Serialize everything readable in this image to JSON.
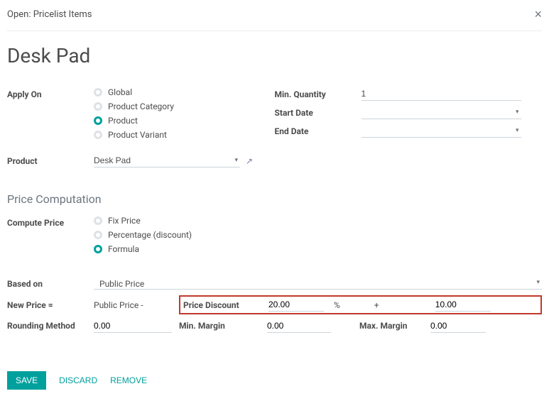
{
  "modal": {
    "title": "Open: Pricelist Items",
    "close": "×"
  },
  "page_title": "Desk Pad",
  "apply_on": {
    "label": "Apply On",
    "options": {
      "global": "Global",
      "category": "Product Category",
      "product": "Product",
      "variant": "Product Variant"
    }
  },
  "product": {
    "label": "Product",
    "value": "Desk Pad"
  },
  "right": {
    "min_qty": {
      "label": "Min. Quantity",
      "value": "1"
    },
    "start_date": {
      "label": "Start Date",
      "value": ""
    },
    "end_date": {
      "label": "End Date",
      "value": ""
    }
  },
  "computation": {
    "title": "Price Computation",
    "compute_label": "Compute Price",
    "options": {
      "fix": "Fix Price",
      "percentage": "Percentage (discount)",
      "formula": "Formula"
    }
  },
  "formula": {
    "based_on": {
      "label": "Based on",
      "value": "Public Price"
    },
    "new_price": {
      "label": "New Price =",
      "base_text": "Public Price -"
    },
    "discount": {
      "label": "Price Discount",
      "value": "20.00",
      "pct": "%",
      "plus": "+",
      "extra": "10.00"
    },
    "rounding": {
      "label": "Rounding Method",
      "value": "0.00"
    },
    "min_margin": {
      "label": "Min. Margin",
      "value": "0.00"
    },
    "max_margin": {
      "label": "Max. Margin",
      "value": "0.00"
    }
  },
  "footer": {
    "save": "Save",
    "discard": "Discard",
    "remove": "Remove"
  },
  "icons": {
    "dropdown": "▾",
    "external": "↗"
  }
}
